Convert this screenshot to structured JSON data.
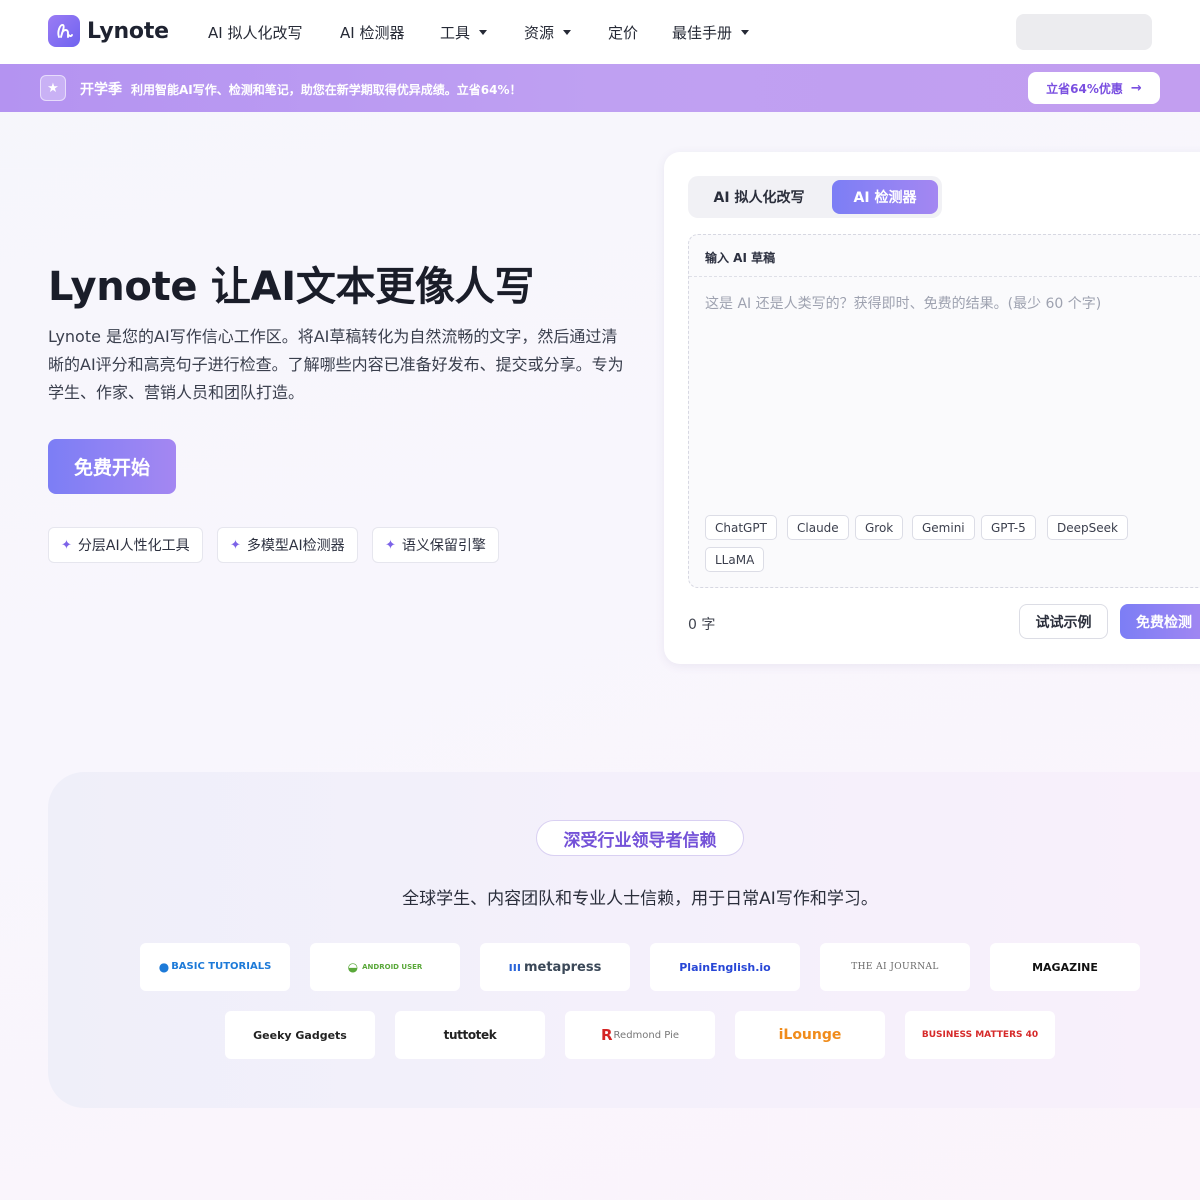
{
  "nav": {
    "brand": "Lynote",
    "items": [
      {
        "label": "AI 拟人化改写",
        "dropdown": false
      },
      {
        "label": "AI 检测器",
        "dropdown": false
      },
      {
        "label": "工具",
        "dropdown": true
      },
      {
        "label": "资源",
        "dropdown": true
      },
      {
        "label": "定价",
        "dropdown": false
      },
      {
        "label": "最佳手册",
        "dropdown": true
      }
    ]
  },
  "promo": {
    "icon": "star-icon",
    "title": "开学季",
    "text": "利用智能AI写作、检测和笔记，助您在新学期取得优异成绩。立省64%！",
    "button": "立省64%优惠",
    "button_icon": "arrow-right-icon",
    "colors": {
      "bar": "#b493f1",
      "button_text": "#7a4fe0"
    }
  },
  "hero": {
    "title": "Lynote 让AI文本更像人写",
    "description": "Lynote 是您的AI写作信心工作区。将AI草稿转化为自然流畅的文字，然后通过清晰的AI评分和高亮句子进行检查。了解哪些内容已准备好发布、提交或分享。专为学生、作家、营销人员和团队打造。",
    "cta": "免费开始",
    "features": [
      "分层AI人性化工具",
      "多模型AI检测器",
      "语义保留引擎"
    ],
    "feature_icon": "sparkle-icon"
  },
  "detector": {
    "tabs": [
      {
        "label": "AI 拟人化改写",
        "active": false
      },
      {
        "label": "AI 检测器",
        "active": true
      }
    ],
    "input_label": "输入 AI 草稿",
    "placeholder": "这是 AI 还是人类写的？获得即时、免费的结果。(最少 60 个字)",
    "models": [
      "ChatGPT",
      "Claude",
      "Grok",
      "Gemini",
      "GPT-5",
      "DeepSeek",
      "LLaMA"
    ],
    "word_count": "0 字",
    "example_button": "试试示例",
    "detect_button": "免费检测",
    "accent": "#7c7ef5"
  },
  "trust": {
    "badge": "深受行业领导者信赖",
    "subtitle": "全球学生、内容团队和专业人士信赖，用于日常AI写作和学习。",
    "logos_row1": [
      "BASIC TUTORIALS",
      "ANDROID USER",
      "metapress",
      "PlainEnglish.io",
      "THE AI JOURNAL",
      "MAGAZINE"
    ],
    "logos_row2": [
      "Geeky Gadgets",
      "tuttotek",
      "Redmond Pie",
      "iLounge",
      "BUSINESS MATTERS 40"
    ]
  }
}
